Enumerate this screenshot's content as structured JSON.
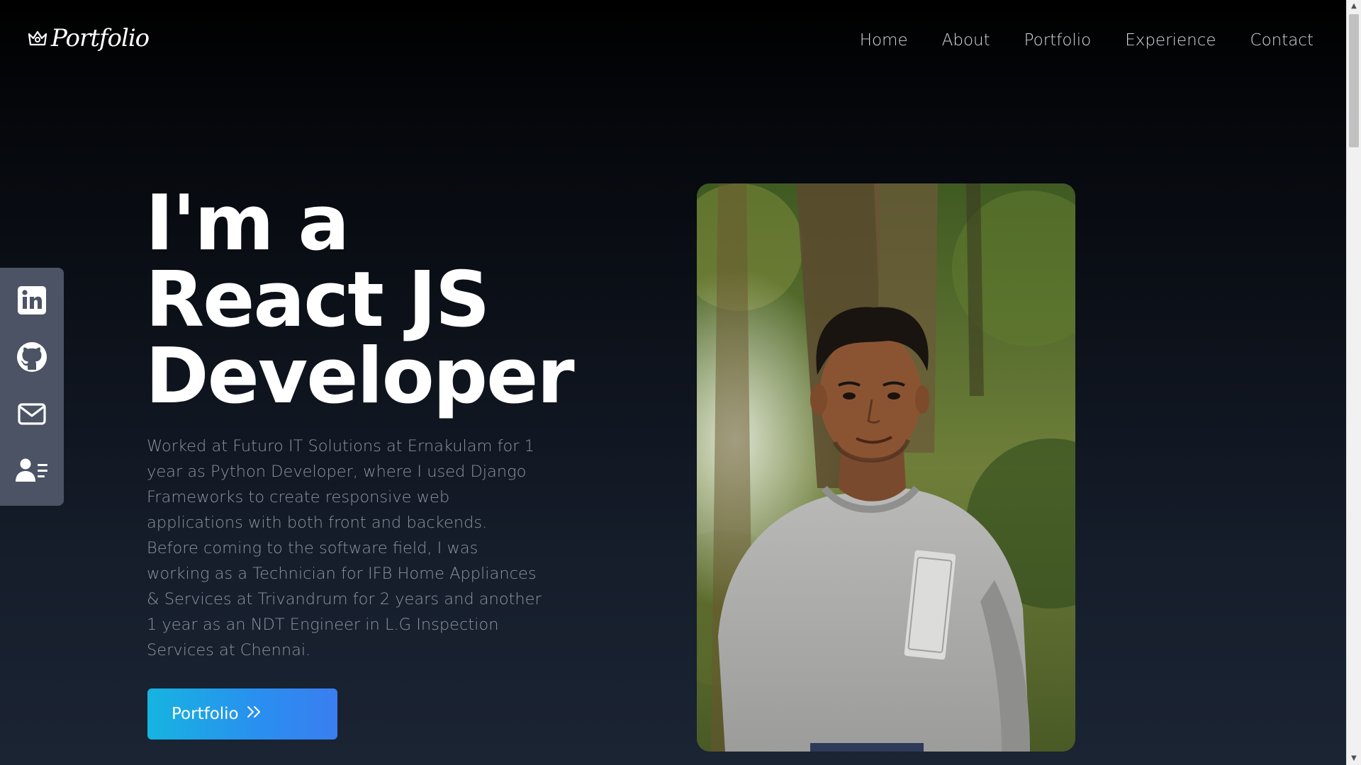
{
  "brand": {
    "logo_text": "Portfolio",
    "logo_icon": "crown-icon"
  },
  "nav": {
    "items": [
      {
        "label": "Home"
      },
      {
        "label": "About"
      },
      {
        "label": "Portfolio"
      },
      {
        "label": "Experience"
      },
      {
        "label": "Contact"
      }
    ]
  },
  "social": {
    "items": [
      {
        "icon": "linkedin-icon"
      },
      {
        "icon": "github-icon"
      },
      {
        "icon": "mail-icon"
      },
      {
        "icon": "resume-icon"
      }
    ]
  },
  "hero": {
    "title_line1": "I'm a",
    "title_line2": "React JS",
    "title_line3": "Developer",
    "description": "Worked at Futuro IT Solutions at Ernakulam for 1 year as Python Developer, where I used Django Frameworks to create responsive web applications with both front and backends. Before coming to the software field, I was working as a Technician for IFB Home Appliances & Services at Trivandrum for 2 years and another 1 year as an NDT Engineer in L.G Inspection Services at Chennai.",
    "cta_label": "Portfolio",
    "cta_icon": "double-chevron-right-icon"
  },
  "colors": {
    "background_top": "#000000",
    "background_bottom": "#1b2433",
    "sidebar": "#4b5364",
    "cta_start": "#16b4e0",
    "cta_end": "#3a7ef0",
    "muted_text": "#8e949e"
  }
}
